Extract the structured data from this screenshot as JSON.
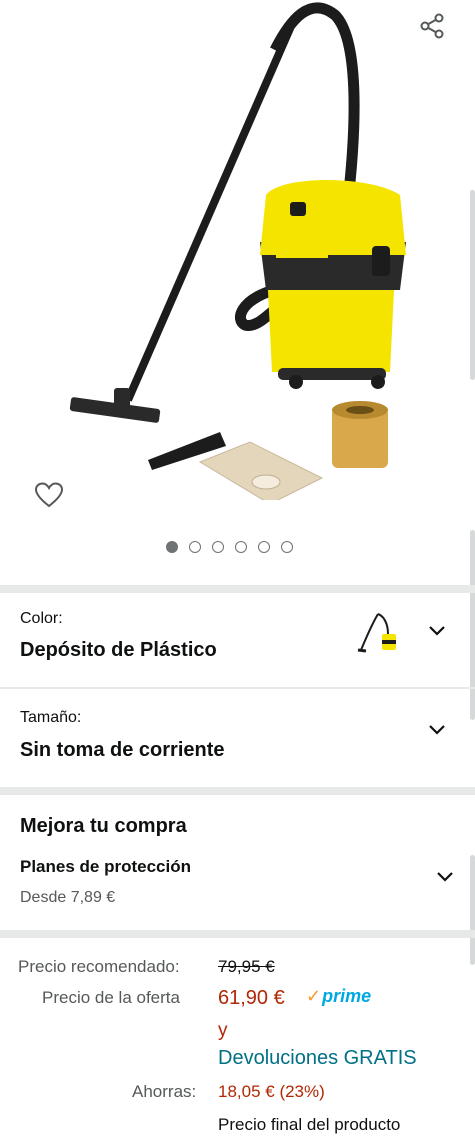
{
  "share": {
    "icon": "share-icon"
  },
  "wishlist": {
    "icon": "heart-outline-icon"
  },
  "gallery": {
    "image": "wet-dry-vacuum-product-image",
    "dot_count": 6,
    "active_dot": 0
  },
  "color": {
    "label": "Color:",
    "value": "Depósito de Plástico",
    "thumbnail": "vacuum-thumbnail-icon",
    "icon": "chevron-down-icon"
  },
  "size": {
    "label": "Tamaño:",
    "value": "Sin toma de corriente",
    "icon": "chevron-down-icon"
  },
  "upgrade": {
    "title": "Mejora tu compra",
    "plan_title": "Planes de protección",
    "plan_price": "Desde 7,89 €",
    "icon": "chevron-down-icon"
  },
  "pricing": {
    "list_label": "Precio recomendado:",
    "list_price": "79,95 €",
    "deal_label": "Precio de la oferta",
    "deal_price": "61,90 €",
    "prime_check": "✓",
    "prime_text": "prime",
    "and_text": "y",
    "returns_text": "Devoluciones GRATIS",
    "savings_label": "Ahorras:",
    "savings_value": "18,05 € (23%)",
    "final_text": "Precio final del producto"
  },
  "colors": {
    "deal": "#B12704",
    "link": "#007185",
    "prime": "#00A8E1",
    "product_yellow": "#F5E400"
  }
}
